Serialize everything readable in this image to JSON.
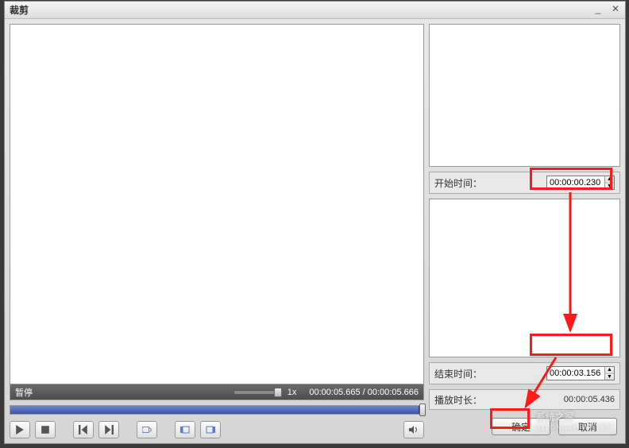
{
  "window": {
    "title": "裁剪"
  },
  "status": {
    "label": "暂停",
    "speed": "1x",
    "time_current": "00:00:05.665",
    "time_total": "00:00:05.666"
  },
  "right": {
    "start_time_label": "开始时间：",
    "start_time_value": "00:00:00.230",
    "end_time_label": "结束时间：",
    "end_time_value": "00:00:03.156",
    "play_duration_label": "播放时长：",
    "play_duration_value": "00:00:05.436"
  },
  "buttons": {
    "ok": "确定",
    "cancel": "取消"
  },
  "watermark": {
    "main": "系统之家",
    "sub": "XITONGZHIJIA.NET"
  }
}
